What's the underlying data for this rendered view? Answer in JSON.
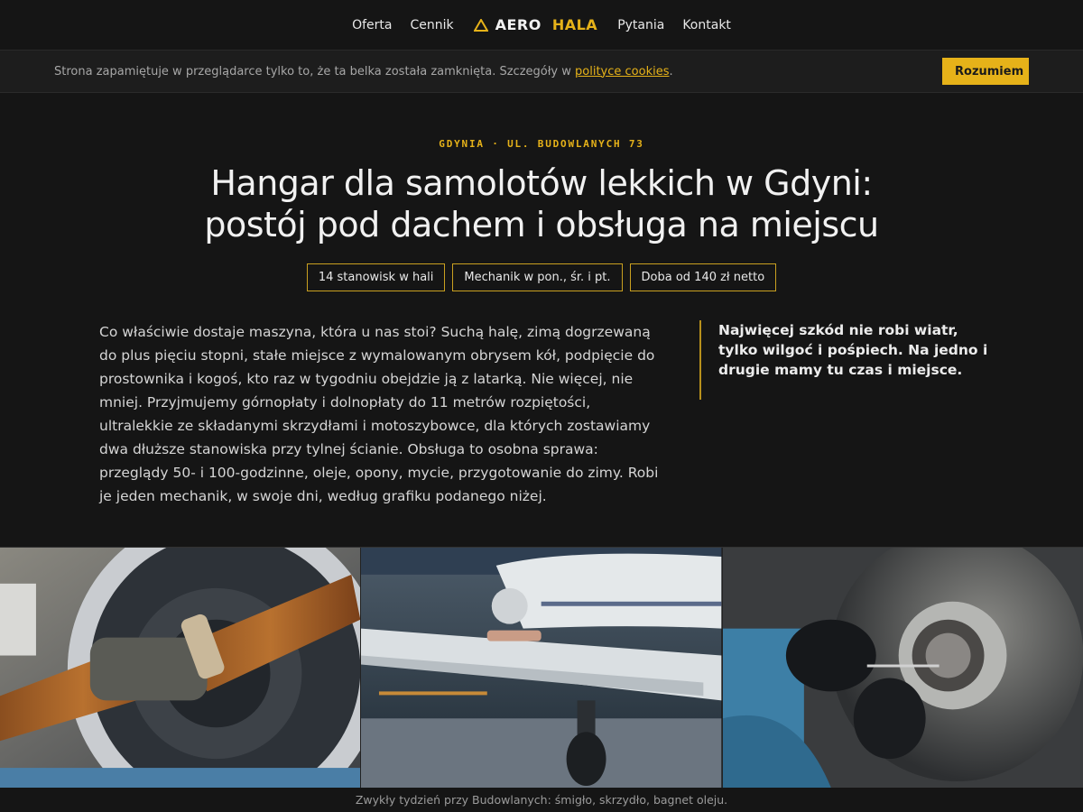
{
  "nav": {
    "items_left": [
      "Oferta",
      "Cennik"
    ],
    "brand_first": "AERO",
    "brand_second": "HALA",
    "items_right": [
      "Pytania",
      "Kontakt"
    ],
    "brand_color": "#e6b219"
  },
  "cookie": {
    "text_before": "Strona zapamiętuje w przeglądarce tylko to, że ta belka została zamknięta. Szczegóły w ",
    "link": "polityce cookies",
    "text_after": ".",
    "button": "Rozumiem"
  },
  "hero": {
    "eyebrow": "GDYNIA · UL. BUDOWLANYCH 73",
    "title_line1": "Hangar dla samolotów lekkich w Gdyni:",
    "title_line2": "postój pod dachem i obsługa na miejscu",
    "tags": [
      "14 stanowisk w hali",
      "Mechanik w pon., śr. i pt.",
      "Doba od 140 zł netto"
    ]
  },
  "content": {
    "lead": "Co właściwie dostaje maszyna, która u nas stoi? Suchą halę, zimą dogrzewaną do plus pięciu stopni, stałe miejsce z wymalowanym obrysem kół, podpięcie do prostownika i kogoś, kto raz w tygodniu obejdzie ją z latarką. Nie więcej, nie mniej. Przyjmujemy górnopłaty i dolnopłaty do 11 metrów rozpiętości, ultralekkie ze składanymi skrzydłami i motoszybowce, dla których zostawiamy dwa dłuższe stanowiska przy tylnej ścianie. Obsługa to osobna sprawa: przeglądy 50- i 100-godzinne, oleje, opony, mycie, przygotowanie do zimy. Robi je jeden mechanik, w swoje dni, według grafiku podanego niżej.",
    "quote": "Najwięcej szkód nie robi wiatr, tylko wilgoć i pośpiech. Na jedno i drugie mamy tu czas i miejsce."
  },
  "gallery": {
    "caption": "Zwykły tydzień przy Budowlanych: śmigło, skrzydło, bagnet oleju."
  }
}
